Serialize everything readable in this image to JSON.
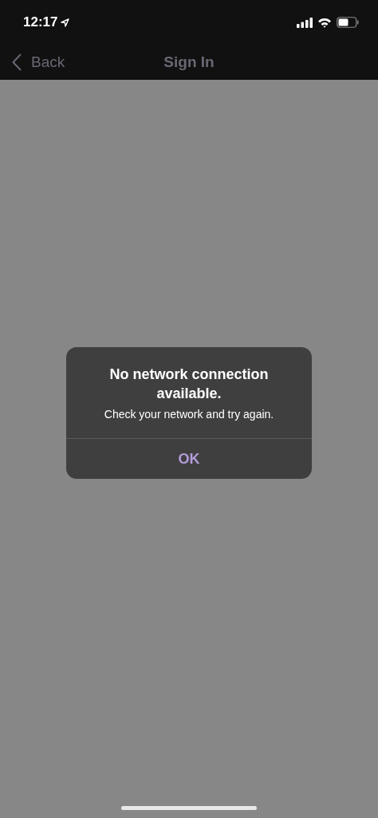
{
  "status_bar": {
    "time": "12:17"
  },
  "nav": {
    "back": "Back",
    "title": "Sign In"
  },
  "alert": {
    "title": "No network connection available.",
    "message": "Check your network and try again.",
    "buttons": [
      "OK"
    ]
  }
}
